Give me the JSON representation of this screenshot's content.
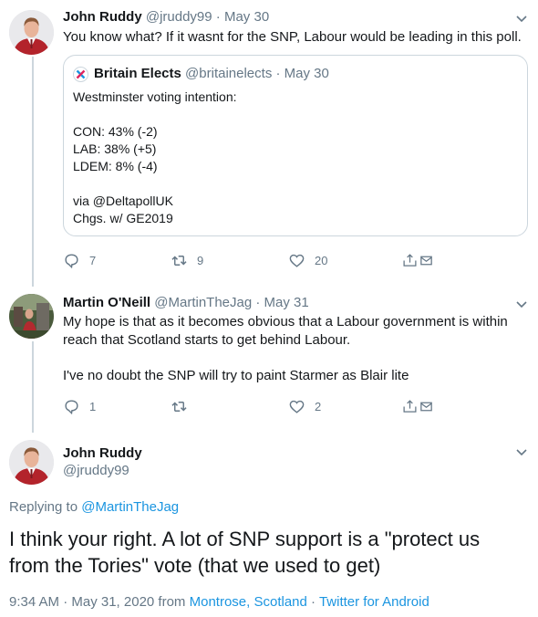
{
  "tweet1": {
    "name": "John Ruddy",
    "handle": "@jruddy99",
    "sep": "·",
    "date": "May 30",
    "text": "You know what? If it wasnt for the SNP, Labour would be leading in this poll.",
    "quote": {
      "name": "Britain Elects",
      "handle": "@britainelects",
      "sep": "·",
      "date": "May 30",
      "lines": [
        "Westminster voting intention:",
        "",
        "CON: 43% (-2)",
        "LAB: 38% (+5)",
        "LDEM: 8% (-4)",
        "",
        "via @DeltapollUK",
        "Chgs. w/ GE2019"
      ]
    },
    "replies": "7",
    "retweets": "9",
    "likes": "20"
  },
  "tweet2": {
    "name": "Martin O'Neill",
    "handle": "@MartinTheJag",
    "sep": "·",
    "date": "May 31",
    "line1": "My hope is that as it becomes obvious that a Labour government is within",
    "line2": "reach that Scotland starts to get behind Labour.",
    "line3": "I've no doubt the SNP will try to paint Starmer as Blair lite",
    "replies": "1",
    "retweets": "",
    "likes": "2"
  },
  "main": {
    "name": "John Ruddy",
    "handle": "@jruddy99",
    "replying_prefix": "Replying to",
    "replying_to": "@MartinTheJag",
    "text_line1": "I think your right. A lot of SNP support is a \"protect us",
    "text_line2": "from the Tories\" vote (that we used to get)",
    "time": "9:34 AM · May 31, 2020 from",
    "location": "Montrose, Scotland",
    "sep": "·",
    "source": "Twitter for Android"
  },
  "icons": [
    "caret-down-icon",
    "reply-icon",
    "retweet-icon",
    "like-icon",
    "share-icon",
    "britain-elects-logo"
  ],
  "colors": {
    "link": "#1b95e0",
    "muted": "#657786",
    "text": "#14171a",
    "border": "#ccd6dd"
  }
}
